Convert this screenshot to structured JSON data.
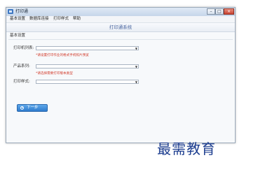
{
  "window": {
    "title": "打印通",
    "controls": {
      "minimize": "–",
      "maximize": "□",
      "close": "×"
    }
  },
  "menu": {
    "items": [
      "基本设置",
      "数据库连接",
      "打印样式",
      "帮助"
    ]
  },
  "header": {
    "title": "打印通系统"
  },
  "section": {
    "title": "基本设置"
  },
  "form": {
    "fields": [
      {
        "label": "打印机列表:",
        "value": "",
        "hint": "*请设置打印作业的格式手机照片预览"
      },
      {
        "label": "产品系列:",
        "value": "",
        "hint": "*请选择需要打印版本类型"
      },
      {
        "label": "打印样式:",
        "value": ""
      }
    ],
    "arrow_icon": "dropdown-arrow-icon"
  },
  "next_button": {
    "label": "下一步",
    "icon": "play-circle-icon"
  },
  "watermark": {
    "text": "最需教育"
  },
  "colors": {
    "accent": "#2f7ccd",
    "hint": "#d23a2a",
    "title": "#4a66a0",
    "watermark": "#1c3d8f"
  }
}
